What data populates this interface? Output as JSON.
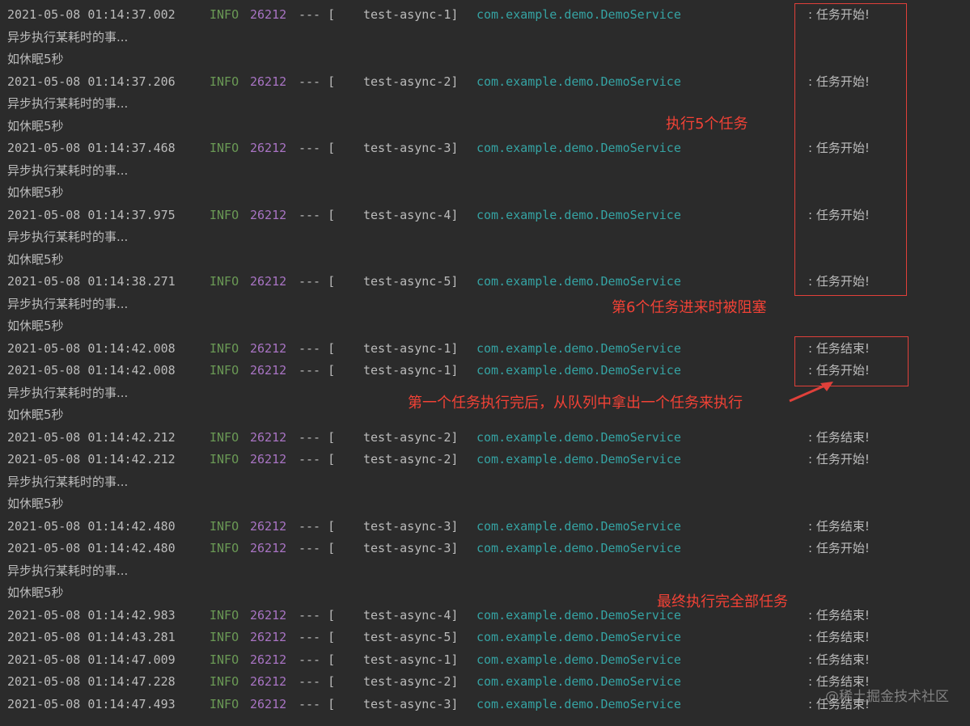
{
  "log_lines": [
    {
      "type": "log",
      "ts": "2021-05-08 01:14:37.002",
      "level": "INFO",
      "pid": "26212",
      "sep": "--- [",
      "thread": "test-async-1]",
      "class": "com.example.demo.DemoService",
      "msg": ": 任务开始!"
    },
    {
      "type": "text",
      "text": "异步执行某耗时的事..."
    },
    {
      "type": "text",
      "text": "如休眠5秒"
    },
    {
      "type": "log",
      "ts": "2021-05-08 01:14:37.206",
      "level": "INFO",
      "pid": "26212",
      "sep": "--- [",
      "thread": "test-async-2]",
      "class": "com.example.demo.DemoService",
      "msg": ": 任务开始!"
    },
    {
      "type": "text",
      "text": "异步执行某耗时的事..."
    },
    {
      "type": "text",
      "text": "如休眠5秒"
    },
    {
      "type": "log",
      "ts": "2021-05-08 01:14:37.468",
      "level": "INFO",
      "pid": "26212",
      "sep": "--- [",
      "thread": "test-async-3]",
      "class": "com.example.demo.DemoService",
      "msg": ": 任务开始!"
    },
    {
      "type": "text",
      "text": "异步执行某耗时的事..."
    },
    {
      "type": "text",
      "text": "如休眠5秒"
    },
    {
      "type": "log",
      "ts": "2021-05-08 01:14:37.975",
      "level": "INFO",
      "pid": "26212",
      "sep": "--- [",
      "thread": "test-async-4]",
      "class": "com.example.demo.DemoService",
      "msg": ": 任务开始!"
    },
    {
      "type": "text",
      "text": "异步执行某耗时的事..."
    },
    {
      "type": "text",
      "text": "如休眠5秒"
    },
    {
      "type": "log",
      "ts": "2021-05-08 01:14:38.271",
      "level": "INFO",
      "pid": "26212",
      "sep": "--- [",
      "thread": "test-async-5]",
      "class": "com.example.demo.DemoService",
      "msg": ": 任务开始!"
    },
    {
      "type": "text",
      "text": "异步执行某耗时的事..."
    },
    {
      "type": "text",
      "text": "如休眠5秒"
    },
    {
      "type": "log",
      "ts": "2021-05-08 01:14:42.008",
      "level": "INFO",
      "pid": "26212",
      "sep": "--- [",
      "thread": "test-async-1]",
      "class": "com.example.demo.DemoService",
      "msg": ": 任务结束!"
    },
    {
      "type": "log",
      "ts": "2021-05-08 01:14:42.008",
      "level": "INFO",
      "pid": "26212",
      "sep": "--- [",
      "thread": "test-async-1]",
      "class": "com.example.demo.DemoService",
      "msg": ": 任务开始!"
    },
    {
      "type": "text",
      "text": "异步执行某耗时的事..."
    },
    {
      "type": "text",
      "text": "如休眠5秒"
    },
    {
      "type": "log",
      "ts": "2021-05-08 01:14:42.212",
      "level": "INFO",
      "pid": "26212",
      "sep": "--- [",
      "thread": "test-async-2]",
      "class": "com.example.demo.DemoService",
      "msg": ": 任务结束!"
    },
    {
      "type": "log",
      "ts": "2021-05-08 01:14:42.212",
      "level": "INFO",
      "pid": "26212",
      "sep": "--- [",
      "thread": "test-async-2]",
      "class": "com.example.demo.DemoService",
      "msg": ": 任务开始!"
    },
    {
      "type": "text",
      "text": "异步执行某耗时的事..."
    },
    {
      "type": "text",
      "text": "如休眠5秒"
    },
    {
      "type": "log",
      "ts": "2021-05-08 01:14:42.480",
      "level": "INFO",
      "pid": "26212",
      "sep": "--- [",
      "thread": "test-async-3]",
      "class": "com.example.demo.DemoService",
      "msg": ": 任务结束!"
    },
    {
      "type": "log",
      "ts": "2021-05-08 01:14:42.480",
      "level": "INFO",
      "pid": "26212",
      "sep": "--- [",
      "thread": "test-async-3]",
      "class": "com.example.demo.DemoService",
      "msg": ": 任务开始!"
    },
    {
      "type": "text",
      "text": "异步执行某耗时的事..."
    },
    {
      "type": "text",
      "text": "如休眠5秒"
    },
    {
      "type": "log",
      "ts": "2021-05-08 01:14:42.983",
      "level": "INFO",
      "pid": "26212",
      "sep": "--- [",
      "thread": "test-async-4]",
      "class": "com.example.demo.DemoService",
      "msg": ": 任务结束!"
    },
    {
      "type": "log",
      "ts": "2021-05-08 01:14:43.281",
      "level": "INFO",
      "pid": "26212",
      "sep": "--- [",
      "thread": "test-async-5]",
      "class": "com.example.demo.DemoService",
      "msg": ": 任务结束!"
    },
    {
      "type": "log",
      "ts": "2021-05-08 01:14:47.009",
      "level": "INFO",
      "pid": "26212",
      "sep": "--- [",
      "thread": "test-async-1]",
      "class": "com.example.demo.DemoService",
      "msg": ": 任务结束!"
    },
    {
      "type": "log",
      "ts": "2021-05-08 01:14:47.228",
      "level": "INFO",
      "pid": "26212",
      "sep": "--- [",
      "thread": "test-async-2]",
      "class": "com.example.demo.DemoService",
      "msg": ": 任务结束!"
    },
    {
      "type": "log",
      "ts": "2021-05-08 01:14:47.493",
      "level": "INFO",
      "pid": "26212",
      "sep": "--- [",
      "thread": "test-async-3]",
      "class": "com.example.demo.DemoService",
      "msg": ": 任务结束!"
    }
  ],
  "annotations": {
    "five_tasks": "执行5个任务",
    "sixth_blocked": "第6个任务进来时被阻塞",
    "first_done": "第一个任务执行完后，从队列中拿出一个任务来执行",
    "all_done": "最终执行完全部任务"
  },
  "watermark": "@稀土掘金技术社区",
  "colors": {
    "background": "#2b2b2b",
    "text": "#bbbbbb",
    "level": "#6a9955",
    "pid": "#a974c4",
    "class": "#35a3a3",
    "annotation": "#f24236"
  }
}
